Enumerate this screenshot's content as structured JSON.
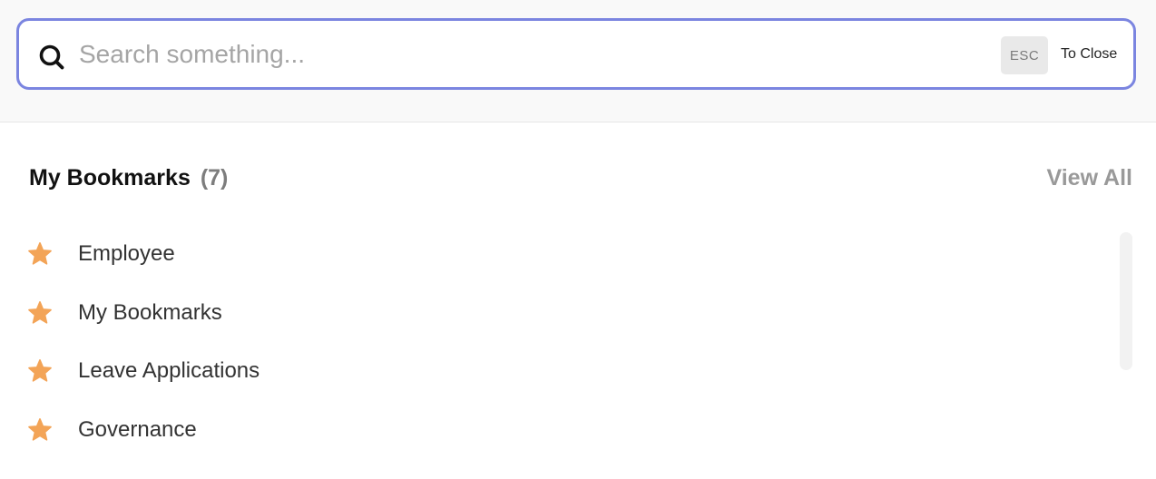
{
  "search": {
    "placeholder": "Search something...",
    "value": "",
    "esc_key": "ESC",
    "esc_hint": "To Close"
  },
  "bookmarks": {
    "title": "My Bookmarks",
    "count": "(7)",
    "view_all": "View All",
    "items": [
      {
        "label": "Employee",
        "icon": "star-icon"
      },
      {
        "label": "My Bookmarks",
        "icon": "star-icon"
      },
      {
        "label": "Leave Applications",
        "icon": "star-icon"
      },
      {
        "label": "Governance",
        "icon": "star-icon"
      }
    ]
  },
  "colors": {
    "accent": "#7b85e0",
    "star": "#f3a457",
    "muted": "#999999"
  }
}
